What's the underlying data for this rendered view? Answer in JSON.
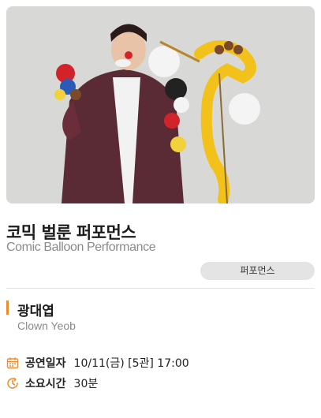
{
  "show": {
    "title_ko": "코믹 벌룬 퍼포먼스",
    "title_en": "Comic Balloon Performance",
    "category": "퍼포먼스"
  },
  "performer": {
    "name_ko": "광대엽",
    "name_en": "Clown Yeob"
  },
  "info": [
    {
      "icon": "calendar-icon",
      "label": "공연일자",
      "value": "10/11(금) [5관] 17:00"
    },
    {
      "icon": "clock-icon",
      "label": "소요시간",
      "value": "30분"
    }
  ],
  "colors": {
    "accent": "#f08a2b",
    "tag_bg": "#e4e4e4",
    "subtext": "#8a8a8a"
  }
}
